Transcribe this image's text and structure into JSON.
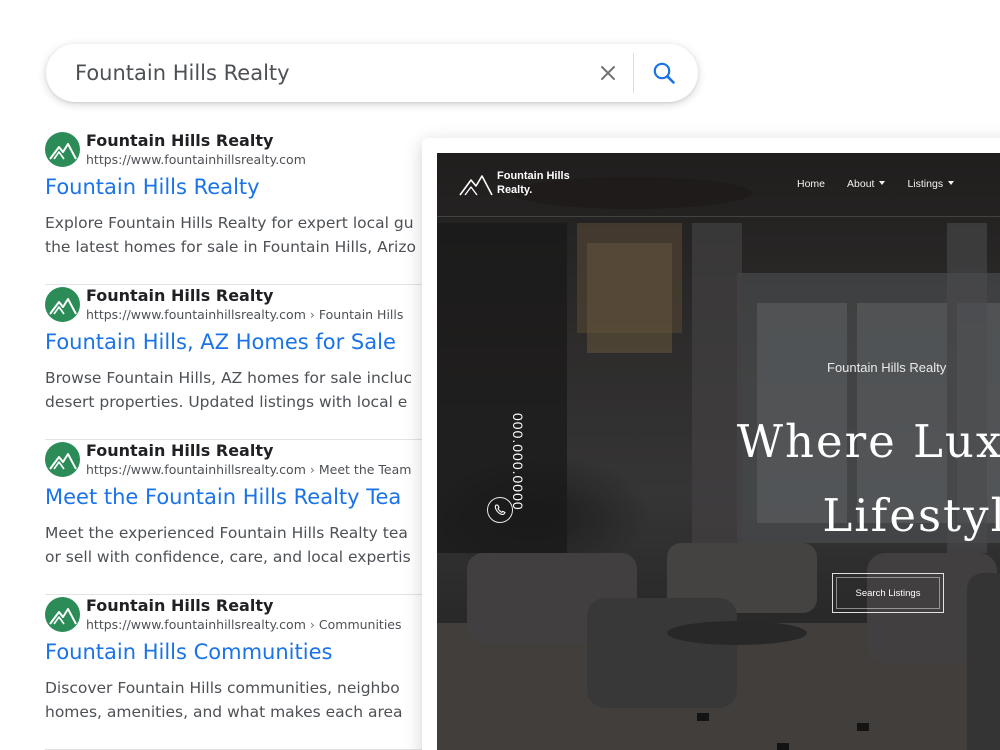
{
  "search": {
    "query": "Fountain Hills Realty"
  },
  "results": [
    {
      "site_name": "Fountain Hills Realty",
      "url": "https://www.fountainhillsrealty.com",
      "breadcrumb": "",
      "title": "Fountain Hills Realty",
      "snippet_line1": "Explore Fountain Hills Realty for expert local gu",
      "snippet_line2": "the latest homes for sale in Fountain Hills, Arizo"
    },
    {
      "site_name": "Fountain Hills Realty",
      "url": "https://www.fountainhillsrealty.com",
      "breadcrumb": "Fountain Hills",
      "title": "Fountain Hills, AZ Homes for Sale",
      "snippet_line1": "Browse Fountain Hills, AZ homes for sale incluc",
      "snippet_line2": "desert properties. Updated listings with local e"
    },
    {
      "site_name": "Fountain Hills Realty",
      "url": "https://www.fountainhillsrealty.com",
      "breadcrumb": "Meet the Team",
      "title": "Meet the Fountain Hills Realty Tea",
      "snippet_line1": "Meet the experienced Fountain Hills Realty tea",
      "snippet_line2": "or sell with confidence, care, and local expertis"
    },
    {
      "site_name": "Fountain Hills Realty",
      "url": "https://www.fountainhillsrealty.com",
      "breadcrumb": "Communities",
      "title": "Fountain Hills Communities",
      "snippet_line1": "Discover Fountain Hills communities, neighbo",
      "snippet_line2": "homes, amenities, and what makes each area"
    }
  ],
  "preview": {
    "logo_line1": "Fountain Hills",
    "logo_line2": "Realty.",
    "nav": {
      "home": "Home",
      "about": "About",
      "listings": "Listings"
    },
    "kicker": "Fountain Hills Realty",
    "hero_line1": "Where Luxury I",
    "hero_line2": "Lifestyle",
    "cta": "Search Listings",
    "phone": "000.000.0000"
  },
  "icons": {
    "clear": "close-icon",
    "search": "search-icon",
    "favicon": "mountain-logo-icon",
    "phone": "phone-icon"
  },
  "colors": {
    "link": "#1a73e8",
    "favicon_bg": "#2b8c58",
    "search_icon": "#1a73e8"
  }
}
